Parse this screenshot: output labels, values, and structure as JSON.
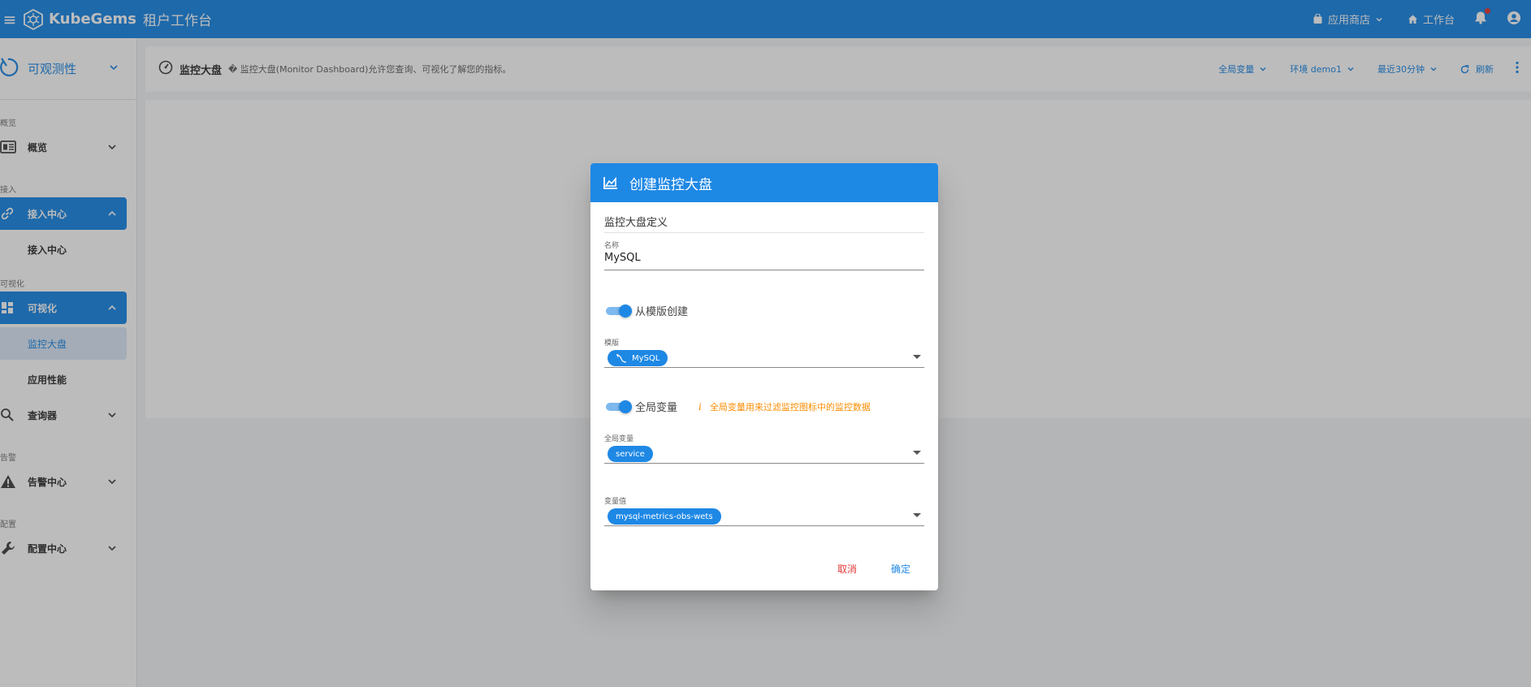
{
  "app": {
    "brand": "KubeGems",
    "subtitle": "租户工作台"
  },
  "topbar": {
    "app_store": "应用商店",
    "workbench": "工作台"
  },
  "sidebar": {
    "section": "可观测性",
    "groups": {
      "overview": "概览",
      "access": "接入",
      "visual": "可视化",
      "alert": "告警",
      "config": "配置"
    },
    "items": {
      "overview": "概览",
      "access_center": "接入中心",
      "access_center_sub": "接入中心",
      "visualize": "可视化",
      "monitor_dashboard": "监控大盘",
      "app_performance": "应用性能",
      "query": "查询器",
      "alert_center": "告警中心",
      "config_center": "配置中心"
    }
  },
  "header": {
    "title": "监控大盘",
    "description": "� 监控大盘(Monitor Dashboard)允许您查询、可视化了解您的指标。",
    "global_vars": "全局变量",
    "env": "环境 demo1",
    "time_range": "最近30分钟",
    "refresh": "刷新"
  },
  "dialog": {
    "title": "创建监控大盘",
    "section_title": "监控大盘定义",
    "name_label": "名称",
    "name_value": "MySQL",
    "from_template_label": "从模版创建",
    "template_label": "模版",
    "template_chip": "MySQL",
    "global_var_switch": "全局变量",
    "global_var_hint": "全局变量用来过滤监控图标中的监控数据",
    "global_var_label": "全局变量",
    "global_var_chip": "service",
    "var_value_label": "变量值",
    "var_value_chip": "mysql-metrics-obs-wets",
    "cancel": "取消",
    "confirm": "确定"
  },
  "colors": {
    "primary": "#1e88e5",
    "danger": "#e53935",
    "warning": "#fb8c00"
  }
}
